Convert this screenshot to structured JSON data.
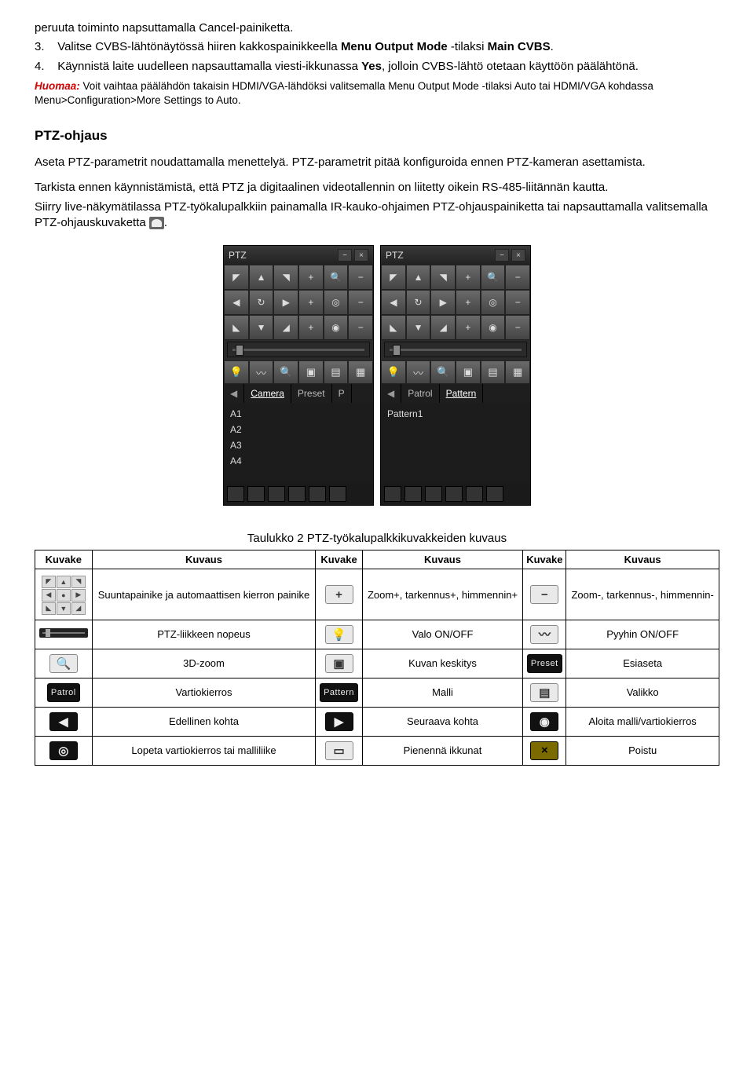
{
  "intro": {
    "line1": "peruuta toiminto napsuttamalla Cancel-painiketta.",
    "line2a": "3.",
    "line2b": "Valitse CVBS-lähtönäytössä hiiren kakkospainikkeella ",
    "line2c": "Menu Output Mode",
    "line2d": " -tilaksi ",
    "line2e": "Main CVBS",
    "line2f": ".",
    "line3a": "4.",
    "line3b": "Käynnistä laite uudelleen napsauttamalla viesti-ikkunassa ",
    "line3c": "Yes",
    "line3d": ", jolloin CVBS-lähtö otetaan käyttöön päälähtönä.",
    "note_label": "Huomaa:",
    "note_text": " Voit vaihtaa päälähdön takaisin HDMI/VGA-lähdöksi valitsemalla Menu Output Mode -tilaksi Auto tai HDMI/VGA kohdassa Menu>Configuration>More Settings to Auto."
  },
  "ptz": {
    "heading": "PTZ-ohjaus",
    "p1": "Aseta PTZ-parametrit noudattamalla menettelyä. PTZ-parametrit pitää konfiguroida ennen PTZ-kameran asettamista.",
    "p2": "Tarkista ennen käynnistämistä, että PTZ ja digitaalinen videotallennin on liitetty oikein RS-485-liitännän kautta.",
    "p3a": "Siirry live-näkymätilassa PTZ-työkalupalkkiin painamalla IR-kauko-ohjaimen PTZ-ohjauspainiketta tai napsauttamalla valitsemalla PTZ-ohjauskuvaketta ",
    "p3b": "."
  },
  "panel": {
    "title": "PTZ",
    "tab_camera": "Camera",
    "tab_preset": "Preset",
    "tab_p": "P",
    "tab_patrol": "Patrol",
    "tab_pattern": "Pattern",
    "items_left": [
      "A1",
      "A2",
      "A3",
      "A4"
    ],
    "items_right": [
      "Pattern1"
    ]
  },
  "table": {
    "caption": "Taulukko 2 PTZ-työkalupalkkikuvakkeiden kuvaus",
    "h1": "Kuvake",
    "h2": "Kuvaus",
    "h3": "Kuvake",
    "h4": "Kuvaus",
    "h5": "Kuvake",
    "h6": "Kuvaus",
    "r1c2": "Suuntapainike ja automaattisen kierron painike",
    "r1c4": "Zoom+, tarkennus+, himmennin+",
    "r1c6": "Zoom-, tarkennus-, himmennin-",
    "r2c2": "PTZ-liikkeen nopeus",
    "r2c4": "Valo ON/OFF",
    "r2c6": "Pyyhin ON/OFF",
    "r3c2": "3D-zoom",
    "r3c4": "Kuvan keskitys",
    "r3c6": "Esiaseta",
    "r4c2": "Vartiokierros",
    "r4c4": "Malli",
    "r4c6": "Valikko",
    "r5c2": "Edellinen kohta",
    "r5c4": "Seuraava kohta",
    "r5c6": "Aloita malli/vartiokierros",
    "r6c2": "Lopeta vartiokierros tai malliliike",
    "r6c4": "Pienennä ikkunat",
    "r6c6": "Poistu",
    "lbl_preset": "Preset",
    "lbl_patrol": "Patrol",
    "lbl_pattern": "Pattern"
  }
}
